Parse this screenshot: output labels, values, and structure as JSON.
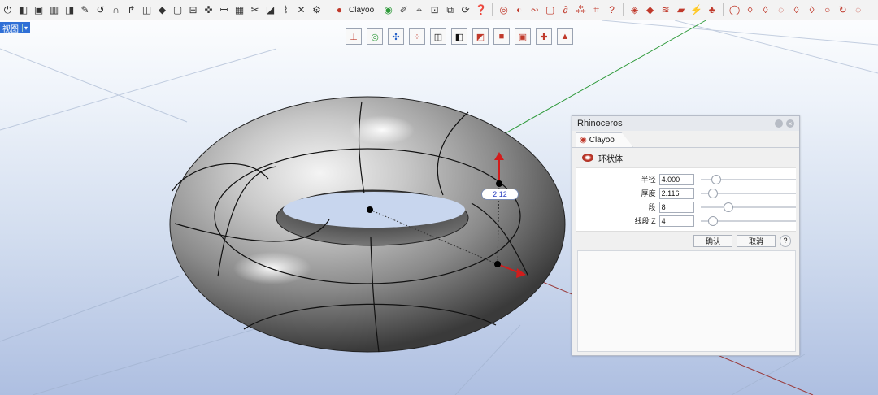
{
  "toolbar": {
    "icons": [
      "power-icon",
      "cube-icon",
      "box-icon",
      "extrude-icon",
      "cage-icon",
      "sweep-icon",
      "revolve-icon",
      "arc-icon",
      "hook-icon",
      "split-icon",
      "shape-icon",
      "frame-icon",
      "grid-icon",
      "puzzle-icon",
      "spiral-icon",
      "mesh-icon",
      "scissors-icon",
      "fold-icon",
      "spring-icon",
      "cross-icon",
      "gear-icon"
    ],
    "plugin_label": "Clayoo",
    "right_icons": [
      "clayoo-icon",
      "sketch-icon",
      "pen-icon",
      "target-icon",
      "lock-icon",
      "help-icon",
      "sphere-icon",
      "link-icon",
      "star-icon",
      "tube-icon",
      "chain-icon",
      "hash-icon",
      "question-icon",
      "eye-icon",
      "diamond-icon",
      "stack-icon",
      "plane-icon",
      "bolt-icon",
      "tree-icon",
      "circle-icon",
      "drop-icon",
      "drop2-icon",
      "drop3-icon",
      "drop4-icon",
      "drop5-icon",
      "refresh-icon",
      "ring-icon"
    ]
  },
  "viewport": {
    "label": "视图"
  },
  "viewport_tools": [
    "gumball-icon",
    "rotate-icon",
    "axis-icon",
    "scatter-icon",
    "cube-wire-icon",
    "cube-shaded-icon",
    "cube-red-icon",
    "cube-solid-icon",
    "scale-icon",
    "move-icon",
    "drop-icon"
  ],
  "dimension_label": "2.12",
  "panel": {
    "title": "Rhinoceros",
    "tab": "Clayoo",
    "command": "环状体",
    "fields": [
      {
        "label": "半径",
        "value": "4.000",
        "pos": 0.12
      },
      {
        "label": "厚度",
        "value": "2.116",
        "pos": 0.08
      },
      {
        "label": "段",
        "value": "8",
        "pos": 0.26
      },
      {
        "label": "线段 Z",
        "value": "4",
        "pos": 0.08
      }
    ],
    "ok_label": "确认",
    "cancel_label": "取消",
    "help_label": "?"
  }
}
